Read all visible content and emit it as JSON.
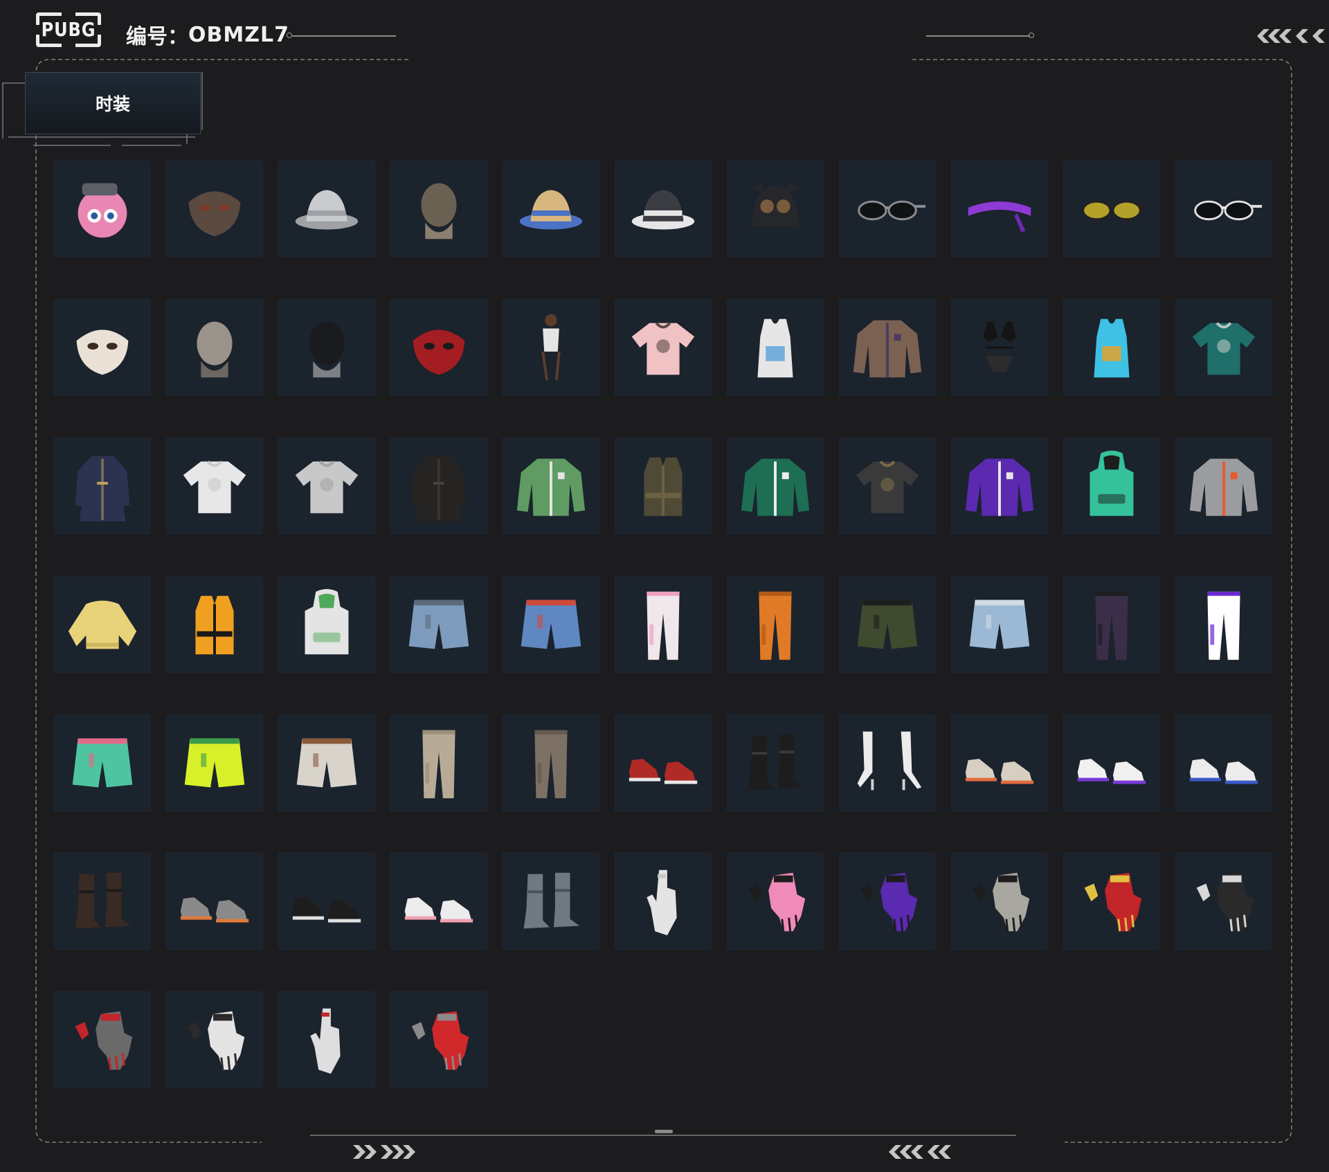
{
  "header": {
    "logo_text": "PUBG",
    "serial_label": "编号：",
    "serial_value": "OBMZL7"
  },
  "tab": {
    "label": "时装"
  },
  "colors": {
    "background": "#1c1c1e",
    "cell": "#1b232d",
    "frame_line": "#8a8a8a",
    "tab_bg": "#1f2a35"
  },
  "items": [
    {
      "icon": "donut-helmet-icon",
      "kind": "helmet",
      "c1": "#e887b3",
      "c2": "#5c5f66"
    },
    {
      "icon": "rag-mask-icon",
      "kind": "mask",
      "c1": "#5b4a40",
      "c2": "#7a3a2c"
    },
    {
      "icon": "bucket-hat-icon",
      "kind": "hat",
      "c1": "#c9cbcf",
      "c2": "#9ea1a6"
    },
    {
      "icon": "dinosaur-mask-icon",
      "kind": "head",
      "c1": "#6a6153",
      "c2": "#8b8070"
    },
    {
      "icon": "straw-hat-icon",
      "kind": "hat",
      "c1": "#d8b77e",
      "c2": "#4b72c4"
    },
    {
      "icon": "shark-hat-icon",
      "kind": "hat",
      "c1": "#3b3d42",
      "c2": "#e6e6e6"
    },
    {
      "icon": "cat-ear-beanie-icon",
      "kind": "beanie",
      "c1": "#26272a",
      "c2": "#7b5b3e"
    },
    {
      "icon": "sunglasses-icon",
      "kind": "glasses",
      "c1": "#111214",
      "c2": "#8a8d92"
    },
    {
      "icon": "purple-headband-icon",
      "kind": "band",
      "c1": "#8e3ad6",
      "c2": "#6d2ab0"
    },
    {
      "icon": "yellow-goggles-icon",
      "kind": "glasses",
      "c1": "#b3a12a",
      "c2": "#222"
    },
    {
      "icon": "white-sunglasses-icon",
      "kind": "glasses",
      "c1": "#0e0f11",
      "c2": "#e0e0e0"
    },
    {
      "icon": "cute-mask-icon",
      "kind": "mask",
      "c1": "#e9e1d6",
      "c2": "#3a2a20"
    },
    {
      "icon": "bald-head-icon",
      "kind": "head",
      "c1": "#9a938b",
      "c2": "#6e675f"
    },
    {
      "icon": "spider-mask-icon",
      "kind": "head",
      "c1": "#1a1b1e",
      "c2": "#7d8085"
    },
    {
      "icon": "red-demon-mask-icon",
      "kind": "mask",
      "c1": "#a31d22",
      "c2": "#1a1a1a"
    },
    {
      "icon": "swimsuit-icon",
      "kind": "body",
      "c1": "#e4e4e4",
      "c2": "#5a3d2a"
    },
    {
      "icon": "pink-tshirt-icon",
      "kind": "shirt",
      "c1": "#f0c2c4",
      "c2": "#5a4a44"
    },
    {
      "icon": "tank-top-icon",
      "kind": "tank",
      "c1": "#e6e6e6",
      "c2": "#5aa0d8"
    },
    {
      "icon": "vest-jacket-icon",
      "kind": "jacket",
      "c1": "#7a6152",
      "c2": "#4d3a5e"
    },
    {
      "icon": "bikini-icon",
      "kind": "bikini",
      "c1": "#141414",
      "c2": "#2c2c2c"
    },
    {
      "icon": "tie-dye-top-icon",
      "kind": "tank",
      "c1": "#3ec1e4",
      "c2": "#f0a020"
    },
    {
      "icon": "hawaiian-shirt-icon",
      "kind": "shirt",
      "c1": "#1f6f6a",
      "c2": "#b9c7c3"
    },
    {
      "icon": "hooded-dress-icon",
      "kind": "coat",
      "c1": "#2b3350",
      "c2": "#c0a060"
    },
    {
      "icon": "white-tshirt-icon",
      "kind": "shirt",
      "c1": "#e7e7e7",
      "c2": "#c9c9c9"
    },
    {
      "icon": "grey-tshirt-icon",
      "kind": "shirt",
      "c1": "#c8c8c8",
      "c2": "#a5a5a5"
    },
    {
      "icon": "leather-coat-icon",
      "kind": "coat",
      "c1": "#262422",
      "c2": "#4a443e"
    },
    {
      "icon": "green-cardigan-icon",
      "kind": "jacket",
      "c1": "#5f9b62",
      "c2": "#e3e3e3"
    },
    {
      "icon": "tactical-vest-icon",
      "kind": "vest",
      "c1": "#4f4a35",
      "c2": "#6a6144"
    },
    {
      "icon": "varsity-jacket-icon",
      "kind": "jacket",
      "c1": "#1d6e52",
      "c2": "#ededed"
    },
    {
      "icon": "gear-shirt-icon",
      "kind": "shirt",
      "c1": "#3a3a3a",
      "c2": "#7a6a4a"
    },
    {
      "icon": "purple-jacket-icon",
      "kind": "jacket",
      "c1": "#5b2ab0",
      "c2": "#e6e6e6"
    },
    {
      "icon": "green-hoodie-icon",
      "kind": "hoodie",
      "c1": "#35c29a",
      "c2": "#1d1d1d"
    },
    {
      "icon": "silver-jacket-icon",
      "kind": "jacket",
      "c1": "#9a9ca0",
      "c2": "#e85a2a"
    },
    {
      "icon": "fuzzy-sweater-icon",
      "kind": "sweater",
      "c1": "#e8d27a",
      "c2": "#cdb660"
    },
    {
      "icon": "puffer-vest-icon",
      "kind": "vest",
      "c1": "#f0a020",
      "c2": "#1a1a1a"
    },
    {
      "icon": "white-hoodie-icon",
      "kind": "hoodie",
      "c1": "#e4e4e4",
      "c2": "#4fa85a"
    },
    {
      "icon": "denim-shorts-icon",
      "kind": "shorts",
      "c1": "#7d9bbd",
      "c2": "#5a6a7a"
    },
    {
      "icon": "jean-shorts-icon",
      "kind": "shorts",
      "c1": "#5f87c1",
      "c2": "#d04a3a"
    },
    {
      "icon": "pink-joggers-icon",
      "kind": "pants",
      "c1": "#efe7ea",
      "c2": "#f2a0c0"
    },
    {
      "icon": "orange-pants-icon",
      "kind": "pants",
      "c1": "#e07a26",
      "c2": "#b45a16"
    },
    {
      "icon": "cargo-shorts-icon",
      "kind": "shorts",
      "c1": "#3f4a2e",
      "c2": "#1e1e1e"
    },
    {
      "icon": "ripped-shorts-icon",
      "kind": "shorts",
      "c1": "#9bb8d4",
      "c2": "#d0dbe5"
    },
    {
      "icon": "tactical-pants-icon",
      "kind": "pants",
      "c1": "#3b2e48",
      "c2": "#1d1d22"
    },
    {
      "icon": "purple-leggings-icon",
      "kind": "pants",
      "c1": "#ffffff",
      "c2": "#6a2ad0"
    },
    {
      "icon": "mint-shorts-icon",
      "kind": "shorts",
      "c1": "#4fc4a0",
      "c2": "#e46a8a"
    },
    {
      "icon": "neon-shorts-icon",
      "kind": "shorts",
      "c1": "#d8f02a",
      "c2": "#3a9b4a"
    },
    {
      "icon": "white-shorts-icon",
      "kind": "shorts",
      "c1": "#d8d4cc",
      "c2": "#8a5a3a"
    },
    {
      "icon": "beige-pants-icon",
      "kind": "pants",
      "c1": "#b7ab98",
      "c2": "#9b8f7c"
    },
    {
      "icon": "brown-pants-icon",
      "kind": "pants",
      "c1": "#7d7064",
      "c2": "#645a50"
    },
    {
      "icon": "red-boots-icon",
      "kind": "shoes",
      "c1": "#b02a26",
      "c2": "#e8e8e8"
    },
    {
      "icon": "black-boots-icon",
      "kind": "boots",
      "c1": "#1d1d1d",
      "c2": "#3a3a3a"
    },
    {
      "icon": "white-heels-icon",
      "kind": "heels",
      "c1": "#ececec",
      "c2": "#cfcfcf"
    },
    {
      "icon": "canvas-sneakers-icon",
      "kind": "shoes",
      "c1": "#d7cfc2",
      "c2": "#e06a40"
    },
    {
      "icon": "purple-sneakers-icon",
      "kind": "shoes",
      "c1": "#f0f0f0",
      "c2": "#7a3ad8"
    },
    {
      "icon": "high-top-sneakers-icon",
      "kind": "shoes",
      "c1": "#ececec",
      "c2": "#3a5ac8"
    },
    {
      "icon": "laced-boots-icon",
      "kind": "boots",
      "c1": "#3a2a24",
      "c2": "#1a1a1a"
    },
    {
      "icon": "grey-sneakers-icon",
      "kind": "shoes",
      "c1": "#8a8a8a",
      "c2": "#e07a3a"
    },
    {
      "icon": "black-sneakers-icon",
      "kind": "shoes",
      "c1": "#1d1d1d",
      "c2": "#e0e0e0"
    },
    {
      "icon": "cleats-icon",
      "kind": "shoes",
      "c1": "#ececec",
      "c2": "#f2a0b0"
    },
    {
      "icon": "work-boots-icon",
      "kind": "boots",
      "c1": "#6e7a82",
      "c2": "#4a5258"
    },
    {
      "icon": "bare-hand-icon",
      "kind": "hand",
      "c1": "#e4e4e4",
      "c2": "#c8c8c8"
    },
    {
      "icon": "pink-gloves-icon",
      "kind": "gloves",
      "c1": "#f08ab8",
      "c2": "#1d1d1d"
    },
    {
      "icon": "purple-gloves-icon",
      "kind": "gloves",
      "c1": "#5a2ab0",
      "c2": "#1d1d1d"
    },
    {
      "icon": "wrap-gloves-icon",
      "kind": "gloves",
      "c1": "#a8a8a0",
      "c2": "#1d1d1d"
    },
    {
      "icon": "red-gloves-icon",
      "kind": "gloves",
      "c1": "#c2252a",
      "c2": "#e0c040"
    },
    {
      "icon": "tactical-gloves-icon",
      "kind": "gloves",
      "c1": "#2a2a2a",
      "c2": "#d8d8d8"
    },
    {
      "icon": "fingerless-gloves-icon",
      "kind": "gloves",
      "c1": "#6a6a6a",
      "c2": "#c2252a"
    },
    {
      "icon": "white-gloves-icon",
      "kind": "gloves",
      "c1": "#e4e4e4",
      "c2": "#2a2a2a"
    },
    {
      "icon": "bracelet-hand-icon",
      "kind": "hand",
      "c1": "#dedede",
      "c2": "#c2252a"
    },
    {
      "icon": "moto-gloves-icon",
      "kind": "gloves",
      "c1": "#d0282a",
      "c2": "#8a8a8a"
    }
  ]
}
